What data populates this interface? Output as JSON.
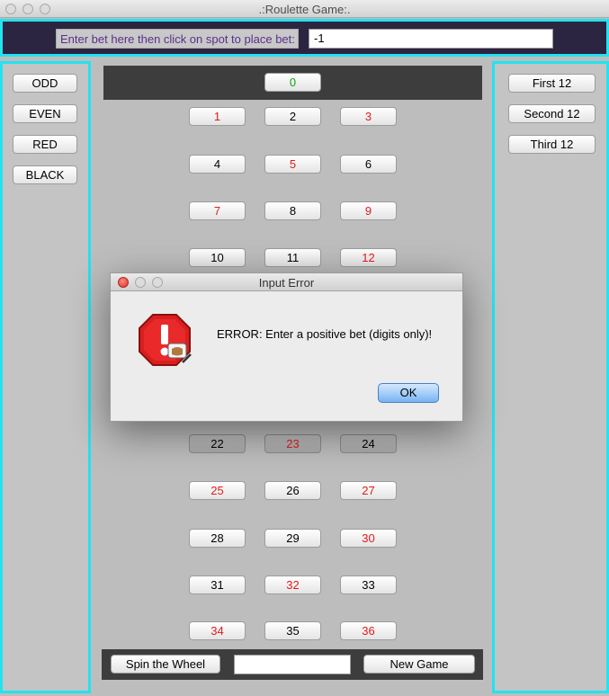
{
  "window": {
    "title": ".:Roulette Game:."
  },
  "bet_bar": {
    "label": "Enter bet here then click on spot to place bet:",
    "value": "-1"
  },
  "left_panel": {
    "buttons": [
      "ODD",
      "EVEN",
      "RED",
      "BLACK"
    ]
  },
  "right_panel": {
    "buttons": [
      "First 12",
      "Second 12",
      "Third 12"
    ]
  },
  "board": {
    "zero": "0",
    "rows": [
      [
        "1",
        "2",
        "3"
      ],
      [
        "4",
        "5",
        "6"
      ],
      [
        "7",
        "8",
        "9"
      ],
      [
        "10",
        "11",
        "12"
      ],
      [
        "22",
        "23",
        "24"
      ],
      [
        "25",
        "26",
        "27"
      ],
      [
        "28",
        "29",
        "30"
      ],
      [
        "31",
        "32",
        "33"
      ],
      [
        "34",
        "35",
        "36"
      ]
    ],
    "red_numbers": [
      "1",
      "3",
      "5",
      "7",
      "9",
      "12",
      "23",
      "25",
      "27",
      "30",
      "32",
      "34",
      "36"
    ],
    "colors": {
      "red": "#e31b1b",
      "green": "#12a312",
      "border_accent": "#22e3f0"
    }
  },
  "bottom": {
    "spin_label": "Spin the Wheel",
    "spin_value": "",
    "new_game_label": "New Game"
  },
  "dialog": {
    "title": "Input Error",
    "message": "ERROR: Enter a positive bet (digits only)!",
    "ok_label": "OK",
    "icon": "stop-warning-icon"
  }
}
